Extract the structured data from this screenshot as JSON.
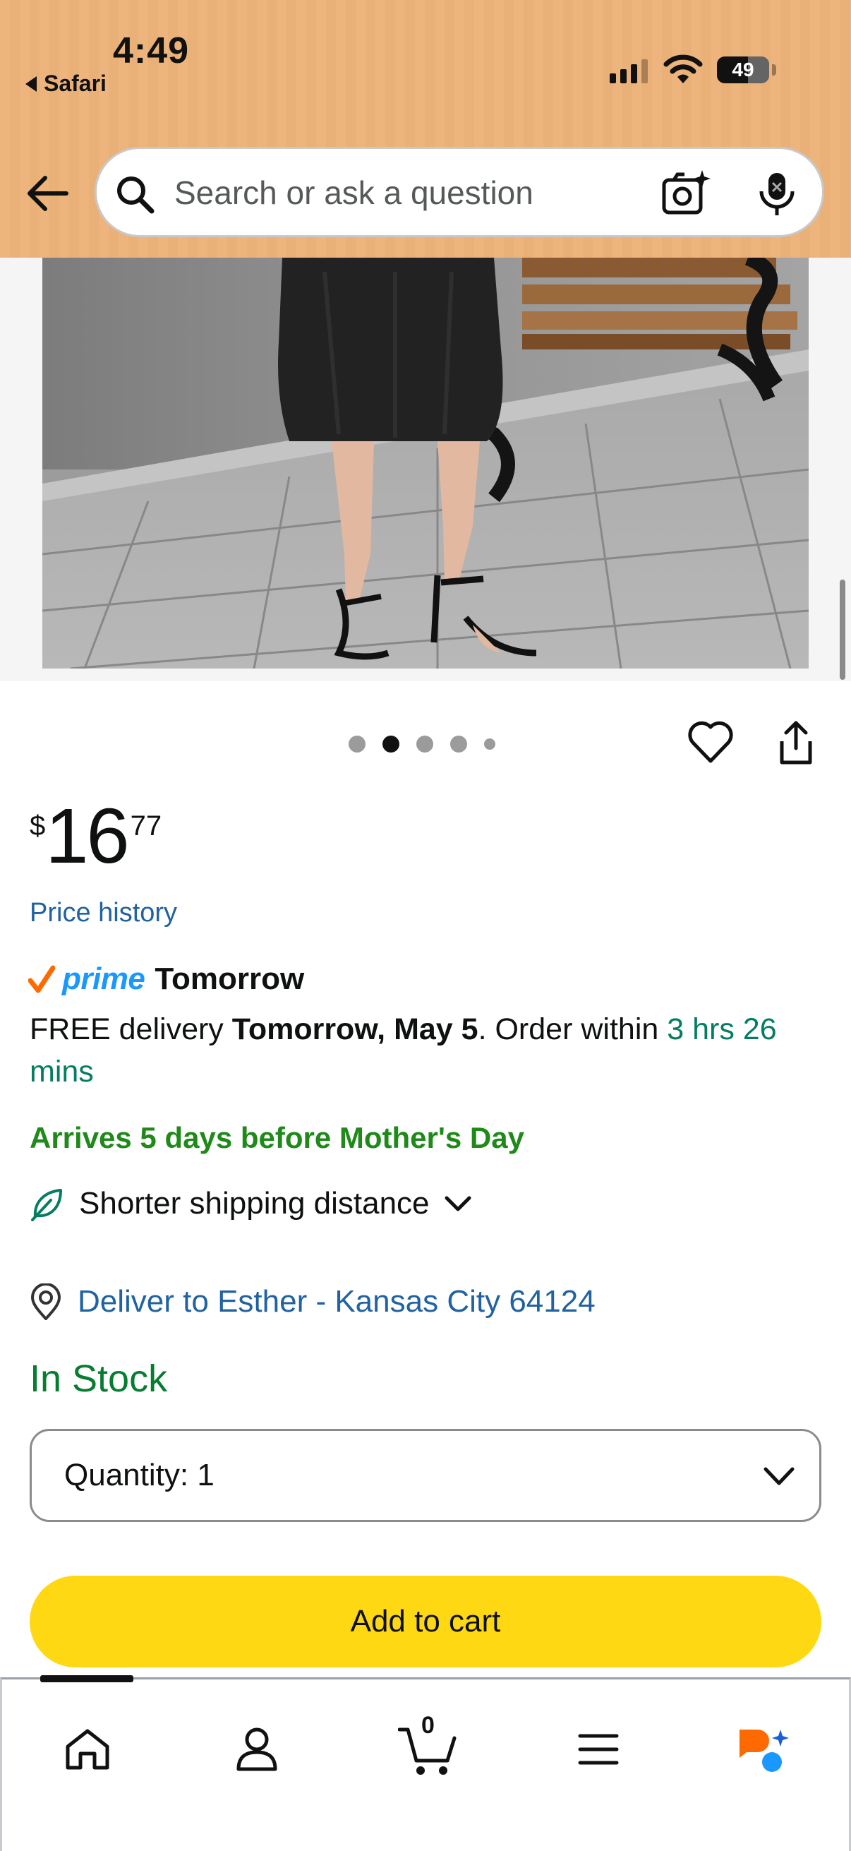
{
  "status_bar": {
    "time": "4:49",
    "back_app": "Safari",
    "battery": "49"
  },
  "header": {
    "search_placeholder": "Search or ask a question",
    "background_color": "#edb57d"
  },
  "carousel": {
    "total_dots": 5,
    "active_index": 1
  },
  "product": {
    "price_symbol": "$",
    "price_whole": "16",
    "price_fraction": "77",
    "price_history_label": "Price history",
    "prime_label": "prime",
    "prime_day": "Tomorrow",
    "delivery_prefix": "FREE delivery ",
    "delivery_date": "Tomorrow, May 5",
    "delivery_mid": ". Order within ",
    "delivery_countdown": "3 hrs 26 mins",
    "arrives_note": "Arrives 5 days before Mother's Day",
    "shipping_label": "Shorter shipping distance",
    "deliver_to": "Deliver to Esther - Kansas City 64124",
    "stock_status": "In Stock",
    "quantity_label": "Quantity:",
    "quantity_value": "1",
    "add_to_cart_label": "Add to cart"
  },
  "bottom_nav": {
    "items": [
      {
        "name": "home",
        "icon": "home-icon"
      },
      {
        "name": "account",
        "icon": "person-icon"
      },
      {
        "name": "cart",
        "icon": "cart-icon"
      },
      {
        "name": "menu",
        "icon": "menu-icon"
      },
      {
        "name": "rufus",
        "icon": "rufus-icon"
      }
    ],
    "cart_count": "0"
  },
  "colors": {
    "link": "#2162a1",
    "prime_blue": "#1a98ff",
    "in_stock": "#067d30",
    "arrives_green": "#1f8a1a",
    "countdown_teal": "#067d62",
    "button_yellow": "#ffd814"
  }
}
